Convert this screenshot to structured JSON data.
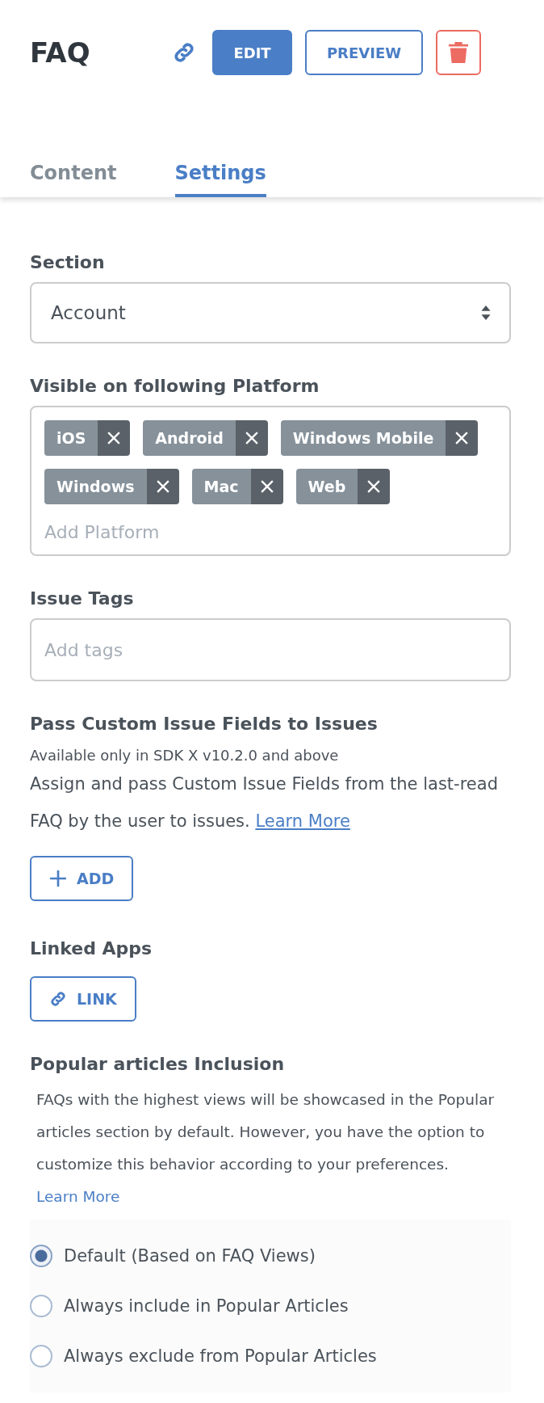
{
  "header": {
    "title": "FAQ",
    "edit_button": "EDIT",
    "preview_button": "PREVIEW"
  },
  "tabs": [
    {
      "label": "Content",
      "selected": false
    },
    {
      "label": "Settings",
      "selected": true
    }
  ],
  "section": {
    "label": "Section",
    "value": "Account"
  },
  "platforms": {
    "label": "Visible on following Platform",
    "tags": [
      "iOS",
      "Android",
      "Windows Mobile",
      "Windows",
      "Mac",
      "Web"
    ],
    "placeholder": "Add Platform"
  },
  "issue_tags": {
    "label": "Issue Tags",
    "placeholder": "Add tags"
  },
  "custom_fields": {
    "heading": "Pass Custom Issue Fields to Issues",
    "note": "Available only in SDK X v10.2.0 and above",
    "description": "Assign and pass Custom Issue Fields from the last-read FAQ by the user to issues.",
    "link": "Learn More",
    "button": "ADD"
  },
  "linked_apps": {
    "heading": "Linked Apps",
    "button": "LINK"
  },
  "popular": {
    "heading": "Popular articles Inclusion",
    "description": "FAQs with the highest views will be showcased in the Popular articles section by default. However, you have the option to customize this behavior according to your preferences.",
    "link": "Learn More",
    "options": [
      {
        "label": "Default (Based on FAQ Views)",
        "selected": true
      },
      {
        "label": "Always include in Popular Articles",
        "selected": false
      },
      {
        "label": "Always exclude from Popular Articles",
        "selected": false
      }
    ]
  }
}
